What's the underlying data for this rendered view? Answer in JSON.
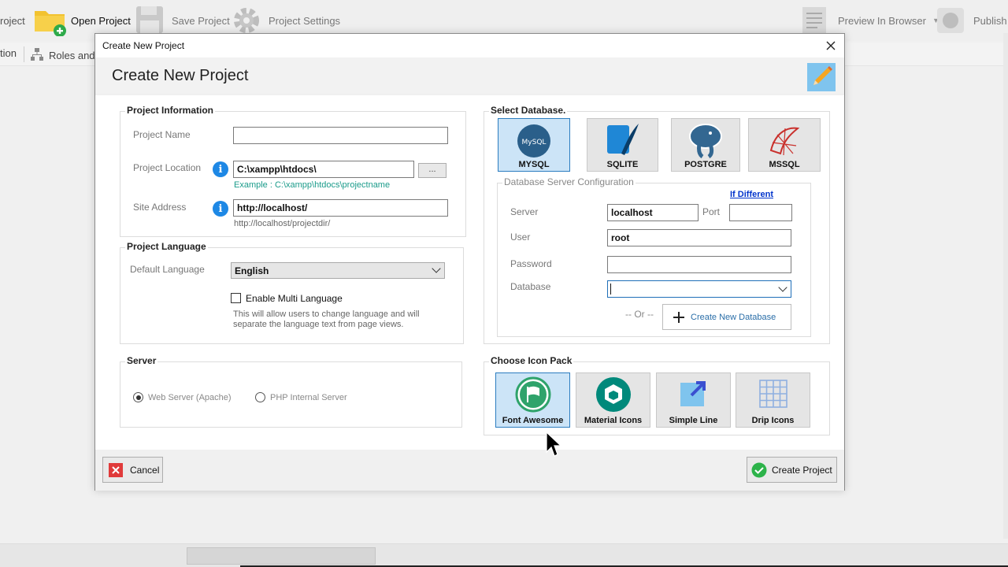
{
  "app": {
    "toolbar": {
      "new_project_label": "roject",
      "open_project_label": "Open Project",
      "save_project_label": "Save Project",
      "project_settings_label": "Project Settings",
      "preview_label": "Preview In Browser",
      "publish_label": "Publish"
    },
    "subbar": {
      "left_label": "tion",
      "roles_label": "Roles and P"
    }
  },
  "dialog": {
    "window_title": "Create New Project",
    "header_title": "Create New Project",
    "project_info": {
      "title": "Project Information",
      "name_label": "Project Name",
      "name_value": "",
      "location_label": "Project Location",
      "location_value": "C:\\xampp\\htdocs\\",
      "browse_label": "...",
      "location_hint": "Example : C:\\xampp\\htdocs\\projectname",
      "site_label": "Site Address",
      "site_value": "http://localhost/",
      "site_hint": "http://localhost/projectdir/"
    },
    "language": {
      "title": "Project Language",
      "default_label": "Default Language",
      "default_value": "English",
      "multi_label": "Enable Multi Language",
      "multi_checked": false,
      "multi_hint_1": "This will allow users to change language and will",
      "multi_hint_2": "separate the language text from page views."
    },
    "server": {
      "title": "Server",
      "option_apache": "Web Server (Apache)",
      "option_php": "PHP Internal Server",
      "selected": "apache"
    },
    "database": {
      "title": "Select Database.",
      "options": [
        "MYSQL",
        "SQLITE",
        "POSTGRE",
        "MSSQL"
      ],
      "selected": "MYSQL",
      "config_title": "Database Server Configuration",
      "if_different": "If Different",
      "server_label": "Server",
      "server_value": "localhost",
      "port_label": "Port",
      "port_value": "",
      "user_label": "User",
      "user_value": "root",
      "password_label": "Password",
      "password_value": "",
      "database_label": "Database",
      "database_value": "",
      "or_label": "-- Or --",
      "create_db_label": "Create New Database"
    },
    "icon_pack": {
      "title": "Choose Icon Pack",
      "options": [
        "Font Awesome",
        "Material Icons",
        "Simple Line",
        "Drip Icons"
      ],
      "selected": "Font Awesome"
    },
    "footer": {
      "cancel_label": "Cancel",
      "create_label": "Create Project"
    }
  },
  "colors": {
    "accent": "#2c7dc0",
    "selected_tile": "#cce4f7",
    "hint_green": "#1a9b8a",
    "cancel_red": "#e03a3a",
    "create_green": "#2db34a"
  }
}
